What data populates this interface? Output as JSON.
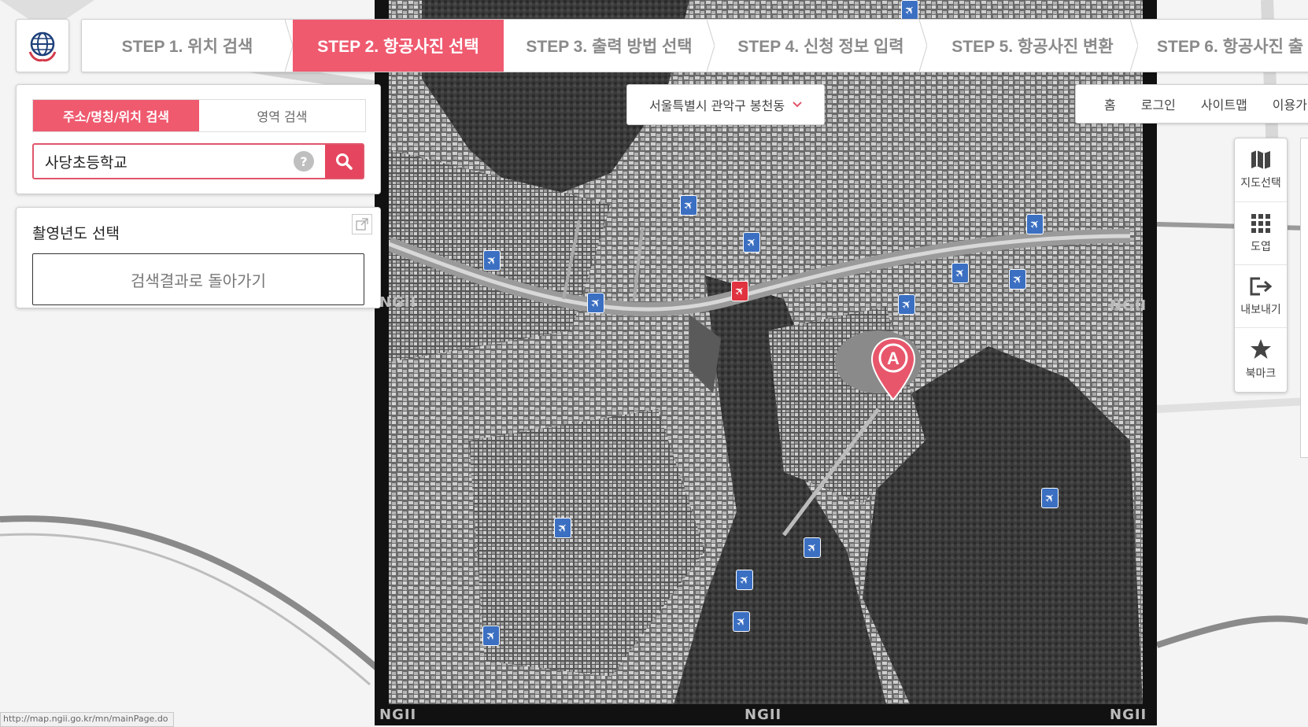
{
  "steps": [
    {
      "label": "STEP 1. 위치 검색"
    },
    {
      "label": "STEP 2. 항공사진 선택"
    },
    {
      "label": "STEP 3. 출력 방법 선택"
    },
    {
      "label": "STEP 4. 신청 정보 입력"
    },
    {
      "label": "STEP 5. 항공사진 변환"
    },
    {
      "label": "STEP 6. 항공사진 출"
    }
  ],
  "search": {
    "tab_address": "주소/명칭/위치 검색",
    "tab_area": "영역 검색",
    "value": "사당초등학교",
    "help": "?"
  },
  "year": {
    "title": "촬영년도 선택",
    "back_label": "검색결과로 돌아가기"
  },
  "location": {
    "label": "서울특별시 관악구 봉천동"
  },
  "top_links": [
    "홈",
    "로그인",
    "사이트맵",
    "이용가이"
  ],
  "toolbar": [
    "지도선택",
    "도엽",
    "내보내기",
    "북마크"
  ],
  "marker": {
    "label": "A",
    "color": "#e8566b"
  },
  "photo_watermark": "NGII",
  "status_url": "http://map.ngii.go.kr/mn/mainPage.do",
  "colors": {
    "accent": "#ef5a6f",
    "search_btn": "#e5455e",
    "plane_marker": "#3b6fc2",
    "plane_marker_selected": "#e0323f"
  }
}
